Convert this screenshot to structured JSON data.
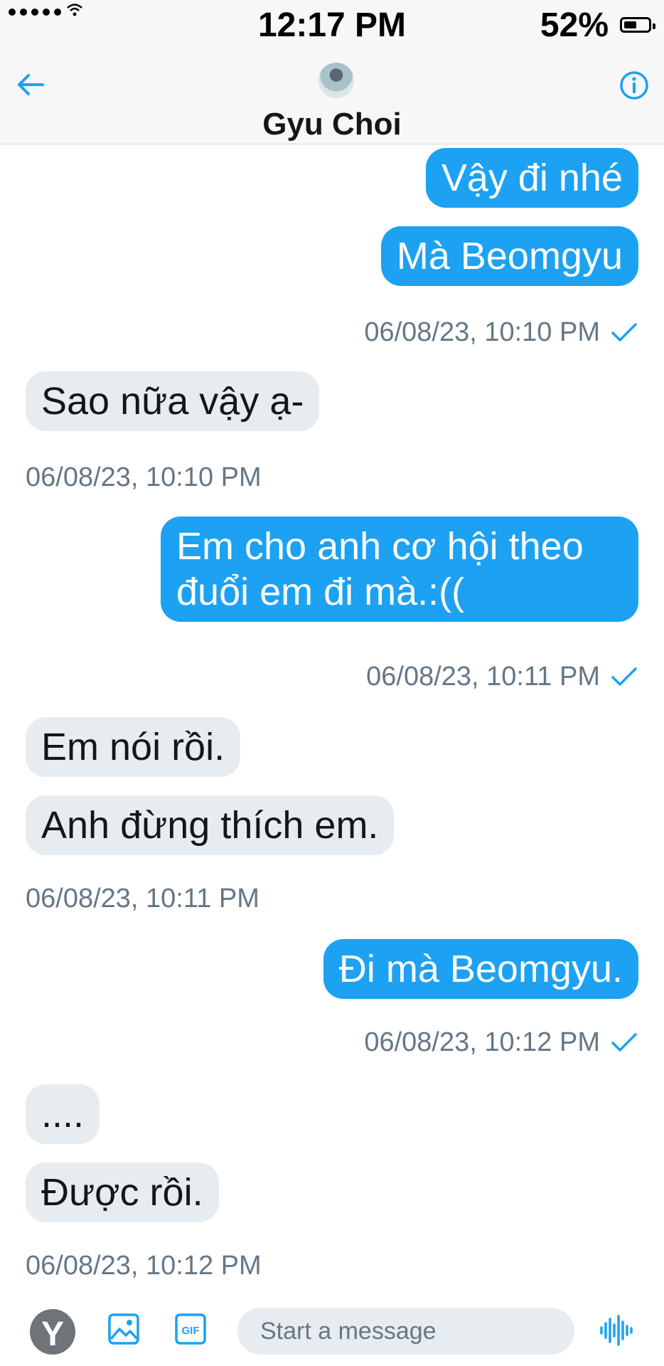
{
  "status_bar": {
    "time": "12:17 PM",
    "battery_percent": "52%",
    "battery_level": 0.52
  },
  "header": {
    "contact_name": "Gyu Choi"
  },
  "messages": [
    {
      "direction": "outgoing",
      "text": "Vậy đi nhé"
    },
    {
      "direction": "outgoing",
      "text": "Mà Beomgyu"
    },
    {
      "direction": "outgoing-timestamp",
      "text": "06/08/23, 10:10 PM"
    },
    {
      "direction": "incoming",
      "text": "Sao nữa vậy ạ-"
    },
    {
      "direction": "incoming-timestamp",
      "text": "06/08/23, 10:10 PM"
    },
    {
      "direction": "outgoing",
      "text_line1": "Em cho anh cơ hội theo",
      "text_line2": "đuổi em đi mà.:(("
    },
    {
      "direction": "outgoing-timestamp",
      "text": "06/08/23, 10:11 PM"
    },
    {
      "direction": "incoming",
      "text": "Em nói rồi."
    },
    {
      "direction": "incoming",
      "text": "Anh đừng thích em."
    },
    {
      "direction": "incoming-timestamp",
      "text": "06/08/23, 10:11 PM"
    },
    {
      "direction": "outgoing",
      "text": "Đi mà Beomgyu."
    },
    {
      "direction": "outgoing-timestamp",
      "text": "06/08/23, 10:12 PM"
    },
    {
      "direction": "incoming",
      "text": "...."
    },
    {
      "direction": "incoming",
      "text": "Được rồi."
    },
    {
      "direction": "incoming-timestamp",
      "text": "06/08/23, 10:12 PM"
    }
  ],
  "composer": {
    "placeholder": "Start a message",
    "avatar_letter": "Y",
    "gif_label": "GIF"
  },
  "colors": {
    "accent": "#1da1f2",
    "incoming_bubble": "#e6ecf0",
    "timestamp": "#657786"
  },
  "icons": [
    "back-arrow-icon",
    "info-icon",
    "checkmark-icon",
    "image-icon",
    "gif-icon",
    "voice-icon"
  ]
}
